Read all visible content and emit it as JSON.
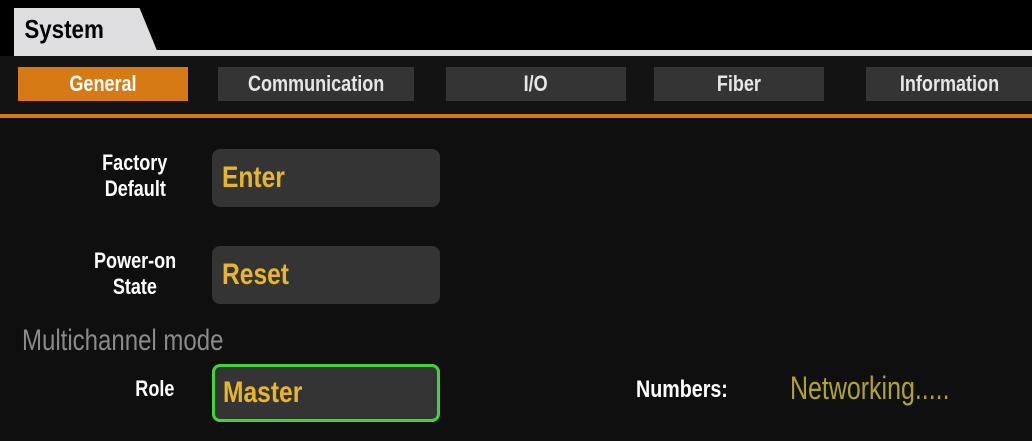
{
  "header": {
    "title": "System"
  },
  "tabs": [
    {
      "label": "General",
      "active": true
    },
    {
      "label": "Communication",
      "active": false
    },
    {
      "label": "I/O",
      "active": false
    },
    {
      "label": "Fiber",
      "active": false
    },
    {
      "label": "Information",
      "active": false
    }
  ],
  "settings": {
    "factory_default": {
      "label_line1": "Factory",
      "label_line2": "Default",
      "value": "Enter"
    },
    "power_on_state": {
      "label_line1": "Power-on",
      "label_line2": "State",
      "value": "Reset"
    }
  },
  "multichannel": {
    "section_title": "Multichannel mode",
    "role": {
      "label": "Role",
      "value": "Master"
    },
    "numbers": {
      "label": "Numbers:",
      "value": "Networking....."
    }
  },
  "colors": {
    "accent": "#d57a14",
    "value_text": "#e8b52b",
    "selected_border": "#44d23a",
    "status_text": "#b0a32b"
  }
}
